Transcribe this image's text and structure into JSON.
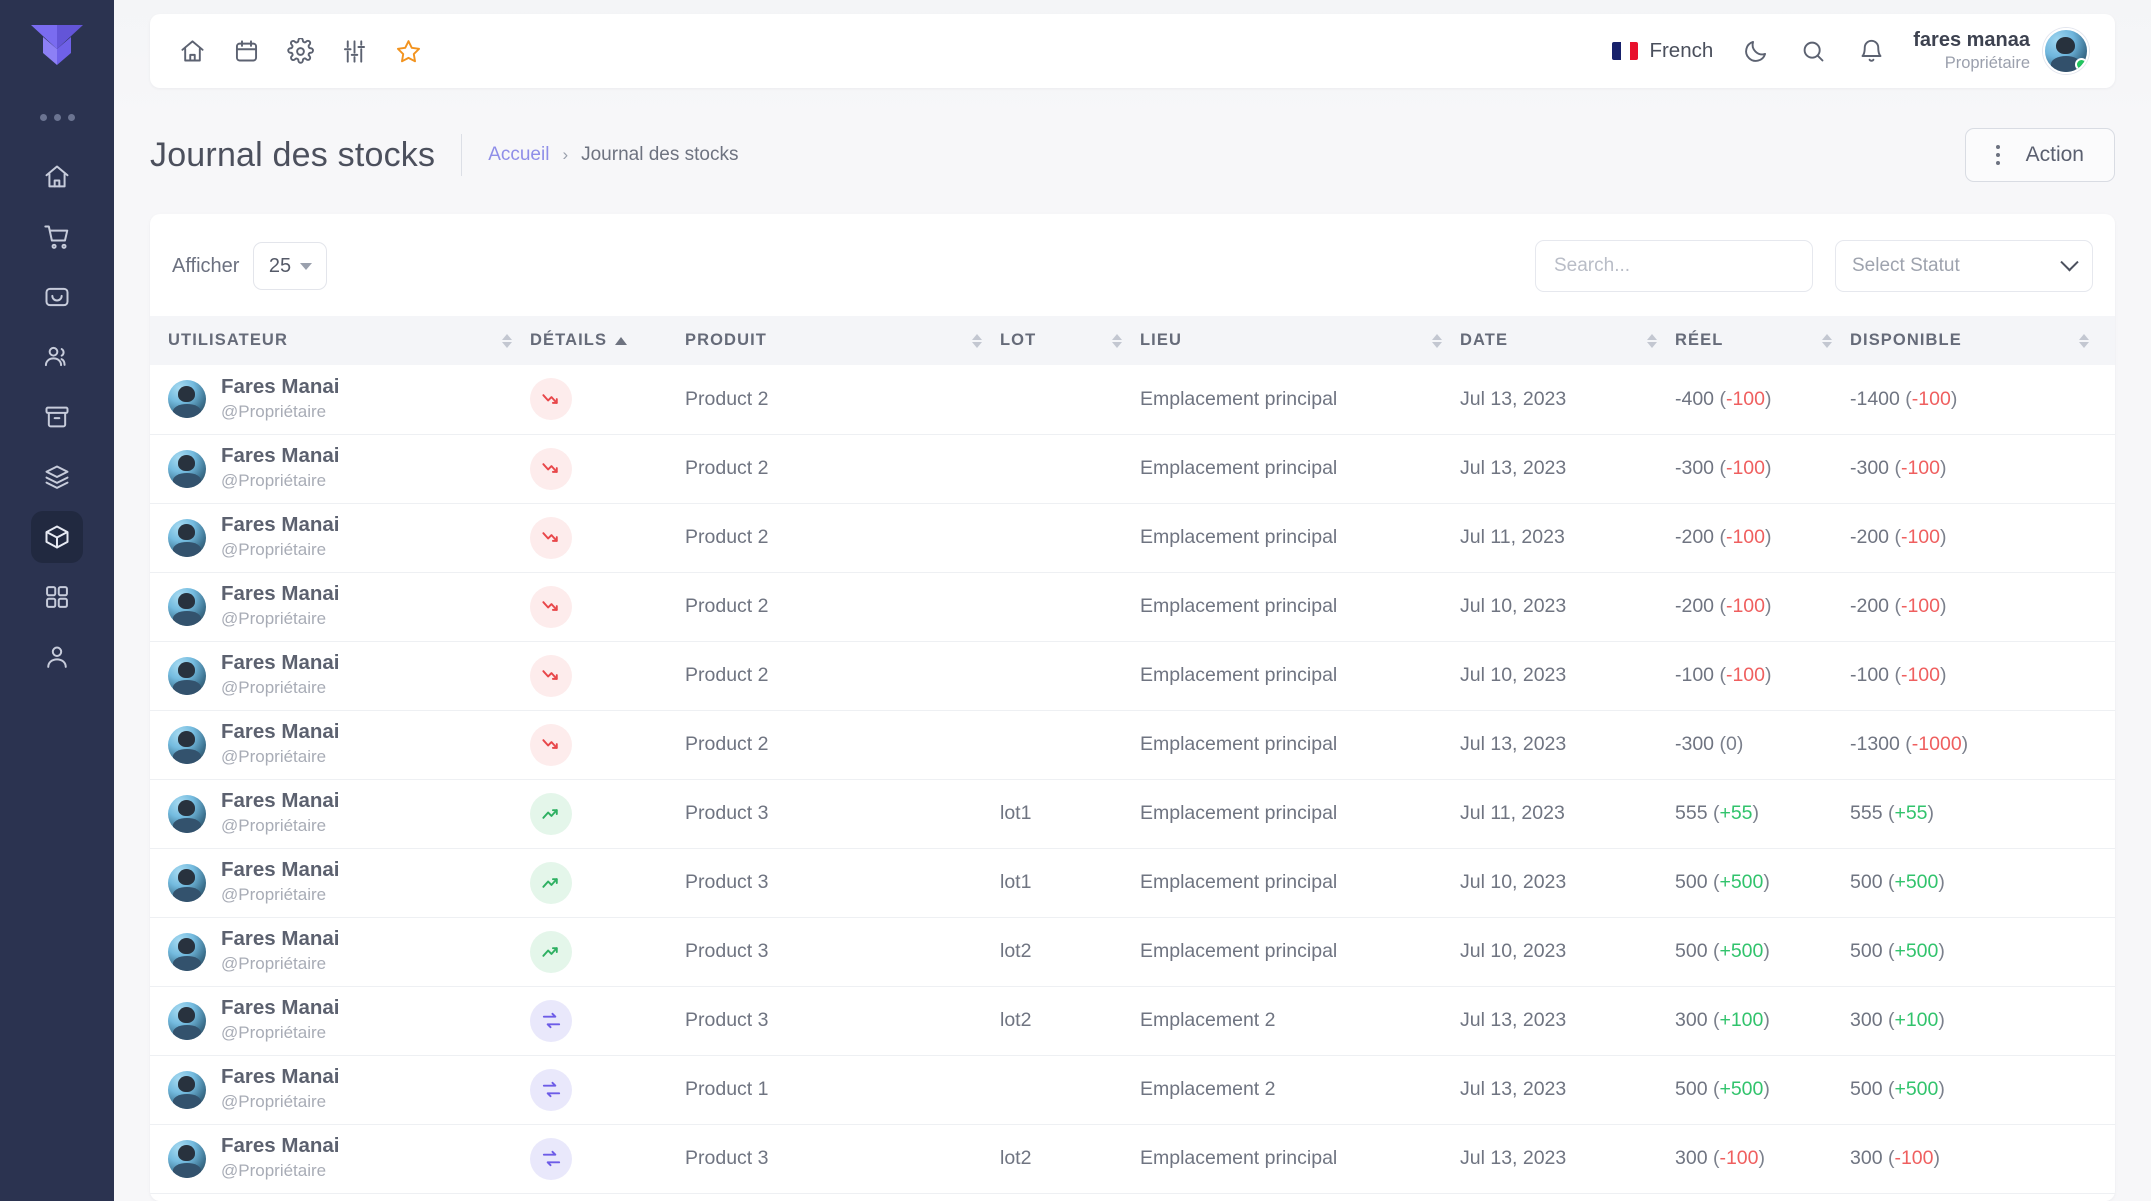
{
  "sidebar": {
    "logo_name": "brand-logo",
    "items": [
      {
        "icon": "home-icon",
        "name": "sidebar-item-home",
        "active": false
      },
      {
        "icon": "cart-icon",
        "name": "sidebar-item-orders",
        "active": false
      },
      {
        "icon": "inbox-icon",
        "name": "sidebar-item-inbox",
        "active": false
      },
      {
        "icon": "users-icon",
        "name": "sidebar-item-customers",
        "active": false
      },
      {
        "icon": "archive-icon",
        "name": "sidebar-item-archive",
        "active": false
      },
      {
        "icon": "layers-icon",
        "name": "sidebar-item-layers",
        "active": false
      },
      {
        "icon": "box-icon",
        "name": "sidebar-item-stock",
        "active": true
      },
      {
        "icon": "grid-icon",
        "name": "sidebar-item-apps",
        "active": false
      },
      {
        "icon": "user-icon",
        "name": "sidebar-item-profile",
        "active": false
      }
    ]
  },
  "topbar": {
    "icons": [
      {
        "icon": "home-icon",
        "name": "topbar-home-button"
      },
      {
        "icon": "calendar-icon",
        "name": "topbar-calendar-button"
      },
      {
        "icon": "gear-icon",
        "name": "topbar-settings-button"
      },
      {
        "icon": "sliders-icon",
        "name": "topbar-filters-button"
      },
      {
        "icon": "star-icon",
        "name": "topbar-favorites-button"
      }
    ],
    "language": "French",
    "dark_mode_icon": "moon-icon",
    "search_icon": "search-icon",
    "notifications_icon": "bell-icon",
    "user_name": "fares manaa",
    "user_role": "Propriétaire",
    "accent_star": "#f2931f"
  },
  "page": {
    "title": "Journal des stocks",
    "breadcrumb": {
      "home": "Accueil",
      "separator": "›",
      "current": "Journal des stocks"
    },
    "action_button": "Action"
  },
  "controls": {
    "show_label": "Afficher",
    "page_size": "25",
    "search_placeholder": "Search...",
    "status_placeholder": "Select Statut"
  },
  "table": {
    "columns": [
      {
        "label": "UTILISATEUR",
        "sort": "both"
      },
      {
        "label": "DÉTAILS",
        "sort": "asc"
      },
      {
        "label": "PRODUIT",
        "sort": "both"
      },
      {
        "label": "LOT",
        "sort": "both"
      },
      {
        "label": "LIEU",
        "sort": "both"
      },
      {
        "label": "DATE",
        "sort": "both"
      },
      {
        "label": "RÉEL",
        "sort": "both"
      },
      {
        "label": "DISPONIBLE",
        "sort": "both"
      }
    ],
    "rows": [
      {
        "user": "Fares Manai",
        "handle": "@Propriétaire",
        "detail": "down",
        "product": "Product 2",
        "lot": "",
        "lieu": "Emplacement principal",
        "date": "Jul 13, 2023",
        "reel_value": "-400",
        "reel_delta": "-100",
        "reel_sign": "neg",
        "dispo_value": "-1400",
        "dispo_delta": "-100",
        "dispo_sign": "neg"
      },
      {
        "user": "Fares Manai",
        "handle": "@Propriétaire",
        "detail": "down",
        "product": "Product 2",
        "lot": "",
        "lieu": "Emplacement principal",
        "date": "Jul 13, 2023",
        "reel_value": "-300",
        "reel_delta": "-100",
        "reel_sign": "neg",
        "dispo_value": "-300",
        "dispo_delta": "-100",
        "dispo_sign": "neg"
      },
      {
        "user": "Fares Manai",
        "handle": "@Propriétaire",
        "detail": "down",
        "product": "Product 2",
        "lot": "",
        "lieu": "Emplacement principal",
        "date": "Jul 11, 2023",
        "reel_value": "-200",
        "reel_delta": "-100",
        "reel_sign": "neg",
        "dispo_value": "-200",
        "dispo_delta": "-100",
        "dispo_sign": "neg"
      },
      {
        "user": "Fares Manai",
        "handle": "@Propriétaire",
        "detail": "down",
        "product": "Product 2",
        "lot": "",
        "lieu": "Emplacement principal",
        "date": "Jul 10, 2023",
        "reel_value": "-200",
        "reel_delta": "-100",
        "reel_sign": "neg",
        "dispo_value": "-200",
        "dispo_delta": "-100",
        "dispo_sign": "neg"
      },
      {
        "user": "Fares Manai",
        "handle": "@Propriétaire",
        "detail": "down",
        "product": "Product 2",
        "lot": "",
        "lieu": "Emplacement principal",
        "date": "Jul 10, 2023",
        "reel_value": "-100",
        "reel_delta": "-100",
        "reel_sign": "neg",
        "dispo_value": "-100",
        "dispo_delta": "-100",
        "dispo_sign": "neg"
      },
      {
        "user": "Fares Manai",
        "handle": "@Propriétaire",
        "detail": "down",
        "product": "Product 2",
        "lot": "",
        "lieu": "Emplacement principal",
        "date": "Jul 13, 2023",
        "reel_value": "-300",
        "reel_delta": "0",
        "reel_sign": "zero",
        "dispo_value": "-1300",
        "dispo_delta": "-1000",
        "dispo_sign": "neg"
      },
      {
        "user": "Fares Manai",
        "handle": "@Propriétaire",
        "detail": "up",
        "product": "Product 3",
        "lot": "lot1",
        "lieu": "Emplacement principal",
        "date": "Jul 11, 2023",
        "reel_value": "555",
        "reel_delta": "+55",
        "reel_sign": "pos",
        "dispo_value": "555",
        "dispo_delta": "+55",
        "dispo_sign": "pos"
      },
      {
        "user": "Fares Manai",
        "handle": "@Propriétaire",
        "detail": "up",
        "product": "Product 3",
        "lot": "lot1",
        "lieu": "Emplacement principal",
        "date": "Jul 10, 2023",
        "reel_value": "500",
        "reel_delta": "+500",
        "reel_sign": "pos",
        "dispo_value": "500",
        "dispo_delta": "+500",
        "dispo_sign": "pos"
      },
      {
        "user": "Fares Manai",
        "handle": "@Propriétaire",
        "detail": "up",
        "product": "Product 3",
        "lot": "lot2",
        "lieu": "Emplacement principal",
        "date": "Jul 10, 2023",
        "reel_value": "500",
        "reel_delta": "+500",
        "reel_sign": "pos",
        "dispo_value": "500",
        "dispo_delta": "+500",
        "dispo_sign": "pos"
      },
      {
        "user": "Fares Manai",
        "handle": "@Propriétaire",
        "detail": "swap",
        "product": "Product 3",
        "lot": "lot2",
        "lieu": "Emplacement 2",
        "date": "Jul 13, 2023",
        "reel_value": "300",
        "reel_delta": "+100",
        "reel_sign": "pos",
        "dispo_value": "300",
        "dispo_delta": "+100",
        "dispo_sign": "pos"
      },
      {
        "user": "Fares Manai",
        "handle": "@Propriétaire",
        "detail": "swap",
        "product": "Product 1",
        "lot": "",
        "lieu": "Emplacement 2",
        "date": "Jul 13, 2023",
        "reel_value": "500",
        "reel_delta": "+500",
        "reel_sign": "pos",
        "dispo_value": "500",
        "dispo_delta": "+500",
        "dispo_sign": "pos"
      },
      {
        "user": "Fares Manai",
        "handle": "@Propriétaire",
        "detail": "swap",
        "product": "Product 3",
        "lot": "lot2",
        "lieu": "Emplacement principal",
        "date": "Jul 13, 2023",
        "reel_value": "300",
        "reel_delta": "-100",
        "reel_sign": "neg",
        "dispo_value": "300",
        "dispo_delta": "-100",
        "dispo_sign": "neg"
      }
    ]
  },
  "colors": {
    "brand": "#6c5ce7",
    "sidebar_bg": "#2b3350",
    "positive": "#31c36c",
    "negative": "#ef5f5f",
    "star": "#f2931f"
  }
}
